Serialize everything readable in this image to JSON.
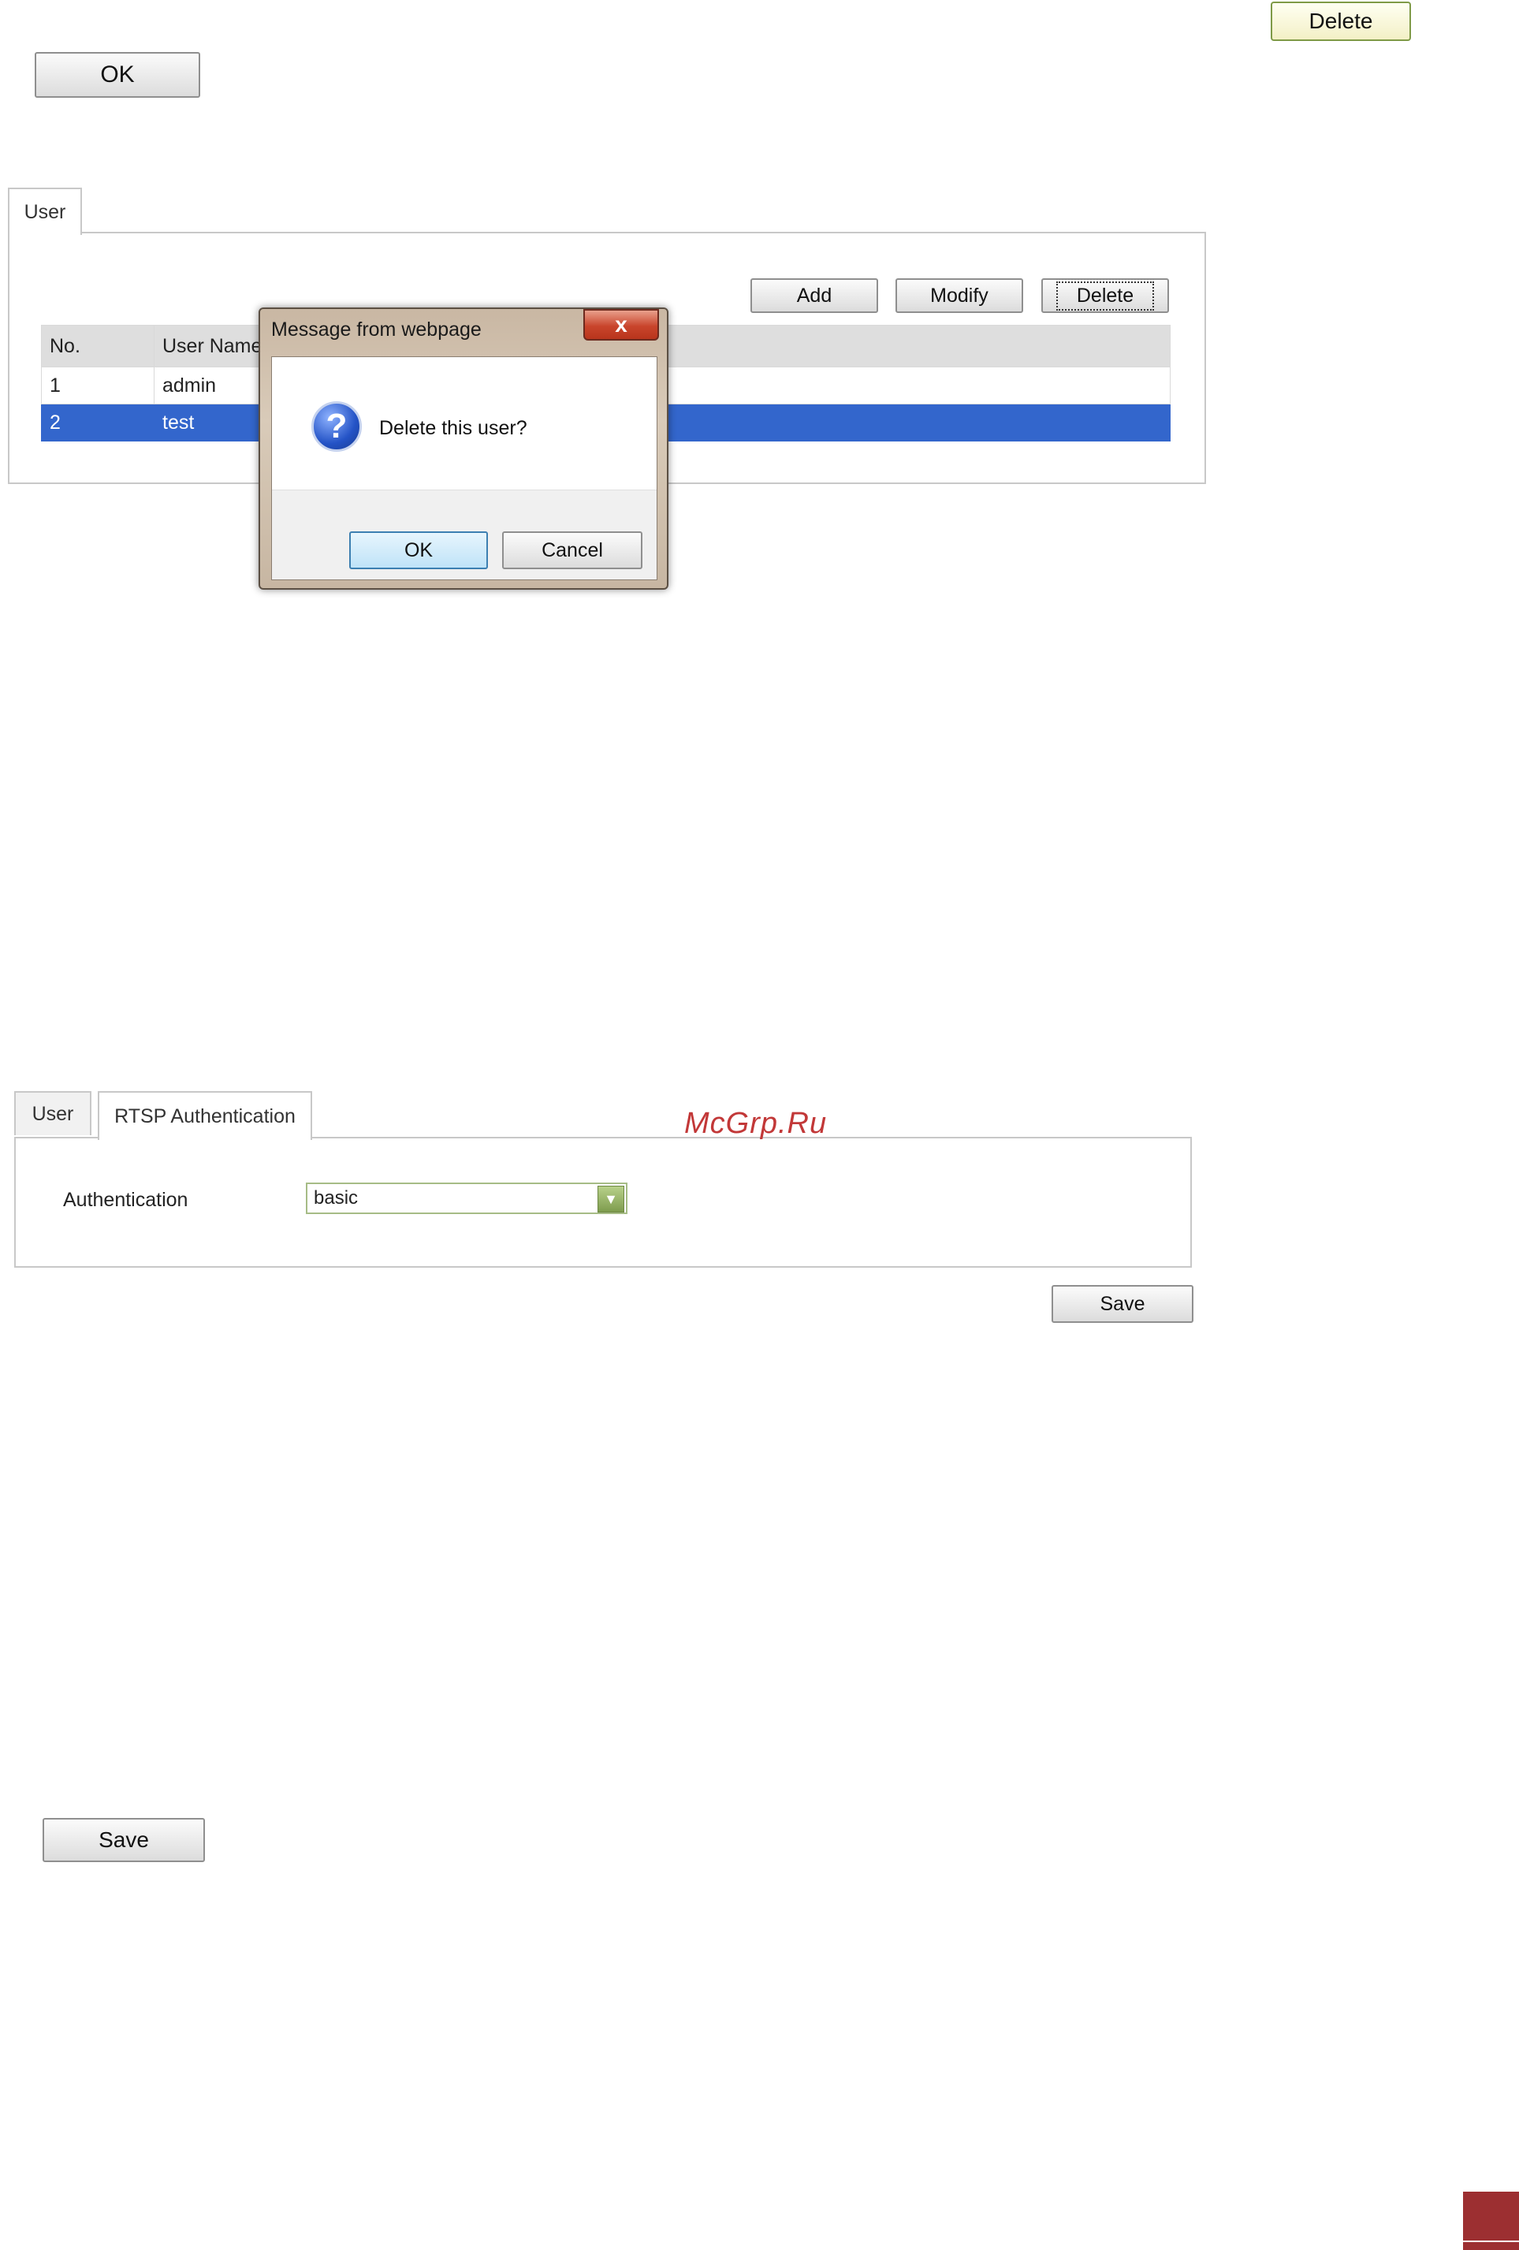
{
  "top": {
    "delete_label": "Delete",
    "ok_label": "OK"
  },
  "user_section": {
    "tab_user": "User",
    "buttons": {
      "add": "Add",
      "modify": "Modify",
      "delete": "Delete"
    },
    "table": {
      "columns": [
        "No.",
        "User Name"
      ],
      "rows": [
        {
          "no": "1",
          "name": "admin"
        },
        {
          "no": "2",
          "name": "test"
        }
      ]
    }
  },
  "dialog": {
    "title": "Message from webpage",
    "close_glyph": "x",
    "message": "Delete this user?",
    "ok": "OK",
    "cancel": "Cancel"
  },
  "rtsp_section": {
    "tab_user": "User",
    "tab_rtsp": "RTSP Authentication",
    "auth_label": "Authentication",
    "auth_value": "basic",
    "save": "Save"
  },
  "watermark": "McGrp.Ru",
  "bottom": {
    "save": "Save"
  },
  "colors": {
    "selected_row": "#3366cc",
    "corner": "#9c2f31",
    "watermark": "#c23838"
  }
}
